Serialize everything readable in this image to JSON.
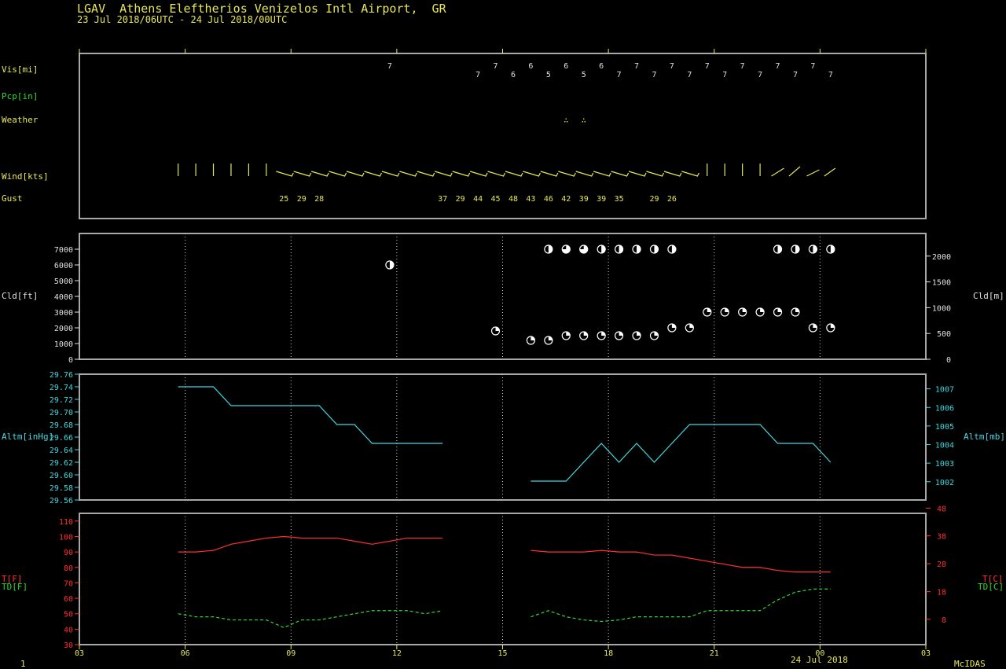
{
  "header": {
    "title": "LGAV  Athens Eleftherios Venizelos Intl Airport,  GR",
    "subtitle": "23 Jul 2018/06UTC - 24 Jul 2018/00UTC"
  },
  "footer": {
    "left_number": "1",
    "date_label": "24 Jul 2018",
    "software": "McIDAS"
  },
  "row_labels": {
    "vis": "Vis[mi]",
    "pcp": "Pcp[in]",
    "weather": "Weather",
    "wind": "Wind[kts]",
    "gust": "Gust",
    "cld_left": "Cld[ft]",
    "cld_right": "Cld[m]",
    "altm_left": "Altm[inHg]",
    "altm_right": "Altm[mb]",
    "t_left": "T[F]",
    "td_left": "TD[F]",
    "t_right": "T[C]",
    "td_right": "TD[C]"
  },
  "colors": {
    "frame": "#a8a8a8",
    "yellow": "#e8e858",
    "white": "#e0e0e0",
    "cyan": "#40d8e0",
    "red": "#ff3030",
    "green": "#30d830"
  },
  "chart_data": [
    {
      "type": "table",
      "name": "surface observations",
      "x_unit": "hour UTC",
      "xlim": [
        3,
        27
      ],
      "x_ticks": [
        3,
        6,
        9,
        12,
        15,
        18,
        21,
        24,
        27
      ],
      "x_tick_labels": [
        "03",
        "06",
        "09",
        "12",
        "15",
        "18",
        "21",
        "00",
        "03"
      ],
      "vis": [
        {
          "x": 11.8,
          "v": "7"
        },
        {
          "x": 14.3,
          "v": "7"
        },
        {
          "x": 14.8,
          "v": "7"
        },
        {
          "x": 15.3,
          "v": "6"
        },
        {
          "x": 15.8,
          "v": "6"
        },
        {
          "x": 16.3,
          "v": "5"
        },
        {
          "x": 16.8,
          "v": "6"
        },
        {
          "x": 17.3,
          "v": "5"
        },
        {
          "x": 17.8,
          "v": "6"
        },
        {
          "x": 18.3,
          "v": "7"
        },
        {
          "x": 18.8,
          "v": "7"
        },
        {
          "x": 19.3,
          "v": "7"
        },
        {
          "x": 19.8,
          "v": "7"
        },
        {
          "x": 20.3,
          "v": "7"
        },
        {
          "x": 20.8,
          "v": "7"
        },
        {
          "x": 21.3,
          "v": "7"
        },
        {
          "x": 21.8,
          "v": "7"
        },
        {
          "x": 22.3,
          "v": "7"
        },
        {
          "x": 22.8,
          "v": "7"
        },
        {
          "x": 23.3,
          "v": "7"
        },
        {
          "x": 23.8,
          "v": "7"
        },
        {
          "x": 24.3,
          "v": "7"
        }
      ],
      "weather": [
        {
          "x": 16.8,
          "symbol": "∴"
        },
        {
          "x": 17.3,
          "symbol": "∴"
        }
      ],
      "wind_x": [
        5.8,
        6.3,
        6.8,
        7.3,
        7.8,
        8.3,
        8.8,
        9.3,
        9.8,
        10.3,
        10.8,
        11.3,
        11.8,
        12.3,
        12.8,
        13.3,
        13.8,
        14.3,
        14.8,
        15.3,
        15.8,
        16.3,
        16.8,
        17.3,
        17.8,
        18.3,
        18.8,
        19.3,
        19.8,
        20.3,
        20.8,
        21.3,
        21.8,
        22.3,
        22.8,
        23.3,
        23.8,
        24.3
      ],
      "gust": [
        {
          "x": 8.8,
          "v": "25"
        },
        {
          "x": 9.3,
          "v": "29"
        },
        {
          "x": 9.8,
          "v": "28"
        },
        {
          "x": 13.3,
          "v": "37"
        },
        {
          "x": 13.8,
          "v": "29"
        },
        {
          "x": 14.3,
          "v": "44"
        },
        {
          "x": 14.8,
          "v": "45"
        },
        {
          "x": 15.3,
          "v": "48"
        },
        {
          "x": 15.8,
          "v": "43"
        },
        {
          "x": 16.3,
          "v": "46"
        },
        {
          "x": 16.8,
          "v": "42"
        },
        {
          "x": 17.3,
          "v": "39"
        },
        {
          "x": 17.8,
          "v": "39"
        },
        {
          "x": 18.3,
          "v": "35"
        },
        {
          "x": 19.3,
          "v": "29"
        },
        {
          "x": 19.8,
          "v": "26"
        }
      ]
    },
    {
      "type": "scatter",
      "name": "cloud",
      "ylim": [
        0,
        7000
      ],
      "y_ticks": [
        0,
        1000,
        2000,
        3000,
        4000,
        5000,
        6000,
        7000
      ],
      "y_right_ticks_m": [
        0,
        500,
        1000,
        1500,
        2000
      ],
      "points": [
        {
          "x": 11.8,
          "y": 6000,
          "cover": "half"
        },
        {
          "x": 14.8,
          "y": 1800,
          "cover": "quarter"
        },
        {
          "x": 15.8,
          "y": 1200,
          "cover": "quarter"
        },
        {
          "x": 16.3,
          "y": 7000,
          "cover": "half"
        },
        {
          "x": 16.3,
          "y": 1200,
          "cover": "quarter"
        },
        {
          "x": 16.8,
          "y": 7000,
          "cover": "three"
        },
        {
          "x": 16.8,
          "y": 1500,
          "cover": "quarter"
        },
        {
          "x": 17.3,
          "y": 7000,
          "cover": "three"
        },
        {
          "x": 17.3,
          "y": 1500,
          "cover": "quarter"
        },
        {
          "x": 17.8,
          "y": 7000,
          "cover": "half"
        },
        {
          "x": 17.8,
          "y": 1500,
          "cover": "quarter"
        },
        {
          "x": 18.3,
          "y": 7000,
          "cover": "half"
        },
        {
          "x": 18.3,
          "y": 1500,
          "cover": "quarter"
        },
        {
          "x": 18.8,
          "y": 7000,
          "cover": "half"
        },
        {
          "x": 18.8,
          "y": 1500,
          "cover": "quarter"
        },
        {
          "x": 19.3,
          "y": 7000,
          "cover": "half"
        },
        {
          "x": 19.3,
          "y": 1500,
          "cover": "quarter"
        },
        {
          "x": 19.8,
          "y": 7000,
          "cover": "half"
        },
        {
          "x": 19.8,
          "y": 2000,
          "cover": "quarter"
        },
        {
          "x": 20.3,
          "y": 2000,
          "cover": "quarter"
        },
        {
          "x": 20.8,
          "y": 3000,
          "cover": "quarter"
        },
        {
          "x": 21.3,
          "y": 3000,
          "cover": "quarter"
        },
        {
          "x": 21.8,
          "y": 3000,
          "cover": "quarter"
        },
        {
          "x": 22.3,
          "y": 3000,
          "cover": "quarter"
        },
        {
          "x": 22.8,
          "y": 7000,
          "cover": "half"
        },
        {
          "x": 22.8,
          "y": 3000,
          "cover": "quarter"
        },
        {
          "x": 23.3,
          "y": 7000,
          "cover": "half"
        },
        {
          "x": 23.3,
          "y": 3000,
          "cover": "quarter"
        },
        {
          "x": 23.8,
          "y": 7000,
          "cover": "half"
        },
        {
          "x": 23.8,
          "y": 2000,
          "cover": "quarter"
        },
        {
          "x": 24.3,
          "y": 7000,
          "cover": "half"
        },
        {
          "x": 24.3,
          "y": 2000,
          "cover": "quarter"
        }
      ]
    },
    {
      "type": "line",
      "name": "altimeter",
      "ylim": [
        29.56,
        29.76
      ],
      "y_ticks": [
        29.56,
        29.58,
        29.6,
        29.62,
        29.64,
        29.66,
        29.68,
        29.7,
        29.72,
        29.74,
        29.76
      ],
      "y_right_ticks_mb": [
        1002,
        1003,
        1004,
        1005,
        1006,
        1007
      ],
      "segments": [
        [
          [
            5.8,
            29.74
          ],
          [
            6.8,
            29.74
          ],
          [
            7.3,
            29.71
          ],
          [
            9.8,
            29.71
          ],
          [
            10.3,
            29.68
          ],
          [
            10.8,
            29.68
          ],
          [
            11.3,
            29.65
          ],
          [
            13.3,
            29.65
          ]
        ],
        [
          [
            15.8,
            29.59
          ],
          [
            16.8,
            29.59
          ],
          [
            17.8,
            29.65
          ],
          [
            18.3,
            29.62
          ],
          [
            18.8,
            29.65
          ],
          [
            19.3,
            29.62
          ],
          [
            20.3,
            29.68
          ],
          [
            22.3,
            29.68
          ],
          [
            22.8,
            29.65
          ],
          [
            23.8,
            29.65
          ],
          [
            24.3,
            29.62
          ]
        ]
      ]
    },
    {
      "type": "line",
      "name": "temperature",
      "ylim": [
        30,
        115
      ],
      "y_ticks": [
        30,
        40,
        50,
        60,
        70,
        80,
        90,
        100,
        110
      ],
      "y_right_ticks_c": [
        8,
        18,
        28,
        38,
        48
      ],
      "series": [
        {
          "key": "t",
          "style": "solid",
          "segments": [
            [
              [
                5.8,
                90
              ],
              [
                6.3,
                90
              ],
              [
                6.8,
                91
              ],
              [
                7.3,
                95
              ],
              [
                7.8,
                97
              ],
              [
                8.3,
                99
              ],
              [
                8.8,
                100
              ],
              [
                9.3,
                99
              ],
              [
                9.8,
                99
              ],
              [
                10.3,
                99
              ],
              [
                10.8,
                97
              ],
              [
                11.3,
                95
              ],
              [
                11.8,
                97
              ],
              [
                12.3,
                99
              ],
              [
                12.8,
                99
              ],
              [
                13.3,
                99
              ]
            ],
            [
              [
                15.8,
                91
              ],
              [
                16.3,
                90
              ],
              [
                16.8,
                90
              ],
              [
                17.3,
                90
              ],
              [
                17.8,
                91
              ],
              [
                18.3,
                90
              ],
              [
                18.8,
                90
              ],
              [
                19.3,
                88
              ],
              [
                19.8,
                88
              ],
              [
                20.3,
                86
              ],
              [
                20.8,
                84
              ],
              [
                21.3,
                82
              ],
              [
                21.8,
                80
              ],
              [
                22.3,
                80
              ],
              [
                22.8,
                78
              ],
              [
                23.3,
                77
              ],
              [
                23.8,
                77
              ],
              [
                24.3,
                77
              ]
            ]
          ]
        },
        {
          "key": "td",
          "style": "dashed",
          "segments": [
            [
              [
                5.8,
                50
              ],
              [
                6.3,
                48
              ],
              [
                6.8,
                48
              ],
              [
                7.3,
                46
              ],
              [
                7.8,
                46
              ],
              [
                8.3,
                46
              ],
              [
                8.8,
                41
              ],
              [
                9.3,
                46
              ],
              [
                9.8,
                46
              ],
              [
                10.3,
                48
              ],
              [
                10.8,
                50
              ],
              [
                11.3,
                52
              ],
              [
                11.8,
                52
              ],
              [
                12.3,
                52
              ],
              [
                12.8,
                50
              ],
              [
                13.3,
                52
              ]
            ],
            [
              [
                15.8,
                48
              ],
              [
                16.3,
                52
              ],
              [
                16.8,
                48
              ],
              [
                17.3,
                46
              ],
              [
                17.8,
                45
              ],
              [
                18.3,
                46
              ],
              [
                18.8,
                48
              ],
              [
                19.3,
                48
              ],
              [
                19.8,
                48
              ],
              [
                20.3,
                48
              ],
              [
                20.8,
                52
              ],
              [
                21.3,
                52
              ],
              [
                21.8,
                52
              ],
              [
                22.3,
                52
              ],
              [
                22.8,
                59
              ],
              [
                23.3,
                64
              ],
              [
                23.8,
                66
              ],
              [
                24.3,
                66
              ]
            ]
          ]
        }
      ]
    }
  ]
}
